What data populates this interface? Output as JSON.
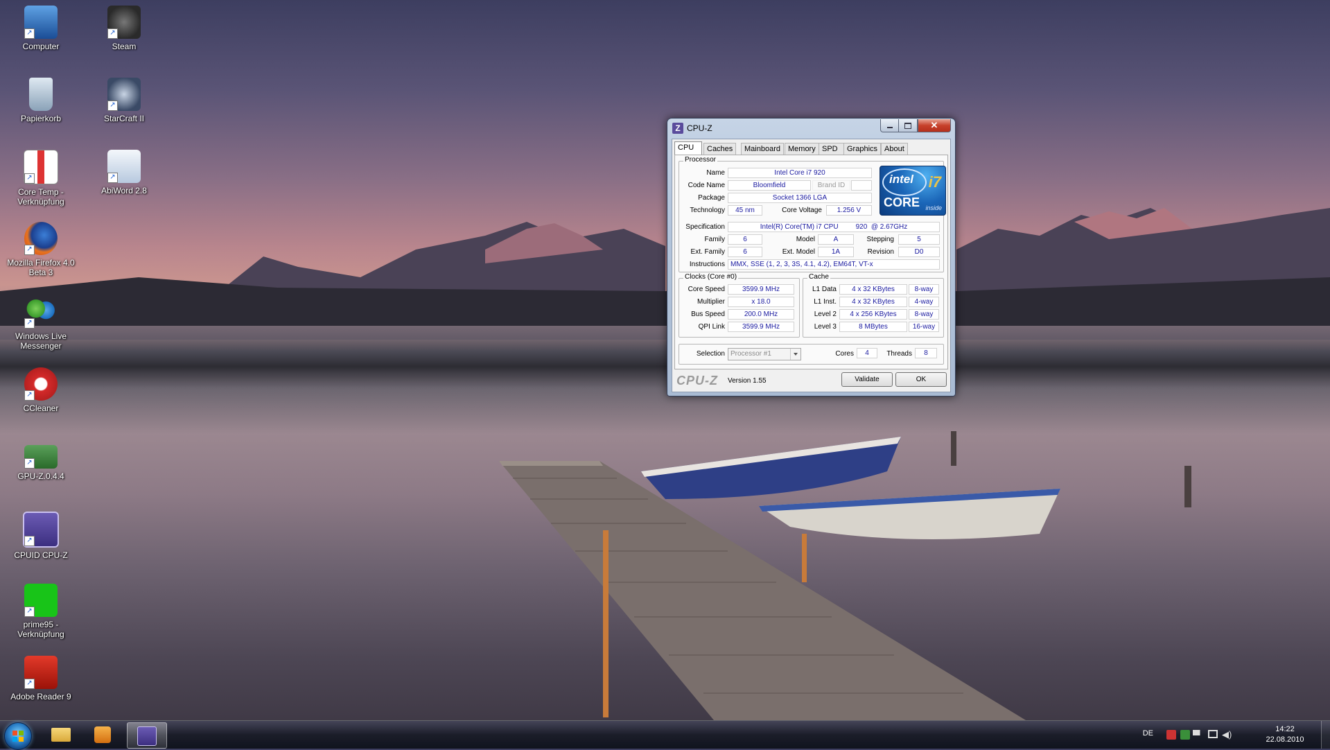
{
  "desktop": {
    "icons": [
      {
        "label": "Computer",
        "icon": "computer-icon"
      },
      {
        "label": "Steam",
        "icon": "steam-icon"
      },
      {
        "label": "Papierkorb",
        "icon": "recycle-bin-icon"
      },
      {
        "label": "StarCraft II",
        "icon": "starcraft-icon"
      },
      {
        "label": "Core Temp -\nVerknüpfung",
        "icon": "thermometer-icon"
      },
      {
        "label": "AbiWord 2.8",
        "icon": "abiword-icon"
      },
      {
        "label": "Mozilla Firefox 4.0\nBeta 3",
        "icon": "firefox-icon"
      },
      {
        "label": "Windows Live\nMessenger",
        "icon": "messenger-icon"
      },
      {
        "label": "CCleaner",
        "icon": "ccleaner-icon"
      },
      {
        "label": "GPU-Z.0.4.4",
        "icon": "gpu-card-icon"
      },
      {
        "label": "CPUID CPU-Z",
        "icon": "cpuz-icon"
      },
      {
        "label": "prime95 -\nVerknüpfung",
        "icon": "prime95-icon"
      },
      {
        "label": "Adobe Reader 9",
        "icon": "adobe-reader-icon"
      }
    ]
  },
  "window": {
    "title": "CPU-Z",
    "close_glyph": "✕",
    "tabs": [
      "CPU",
      "Caches",
      "Mainboard",
      "Memory",
      "SPD",
      "Graphics",
      "About"
    ],
    "selected_tab": "CPU",
    "processor": {
      "group_label": "Processor",
      "name_label": "Name",
      "name": "Intel Core i7 920",
      "codename_label": "Code Name",
      "codename": "Bloomfield",
      "brandid_label": "Brand ID",
      "package_label": "Package",
      "package": "Socket 1366 LGA",
      "technology_label": "Technology",
      "technology": "45 nm",
      "corevoltage_label": "Core Voltage",
      "corevoltage": "1.256 V",
      "spec_label": "Specification",
      "spec": "Intel(R) Core(TM) i7 CPU         920  @ 2.67GHz",
      "family_label": "Family",
      "family": "6",
      "model_label": "Model",
      "model": "A",
      "stepping_label": "Stepping",
      "stepping": "5",
      "extfamily_label": "Ext. Family",
      "extfamily": "6",
      "extmodel_label": "Ext. Model",
      "extmodel": "1A",
      "revision_label": "Revision",
      "revision": "D0",
      "instructions_label": "Instructions",
      "instructions": "MMX, SSE (1, 2, 3, 3S, 4.1, 4.2), EM64T, VT-x",
      "logo": {
        "brand": "intel",
        "core": "CORE",
        "model": "i7",
        "inside": "inside"
      }
    },
    "clocks": {
      "group_label": "Clocks (Core #0)",
      "corespeed_label": "Core Speed",
      "corespeed": "3599.9 MHz",
      "multiplier_label": "Multiplier",
      "multiplier": "x 18.0",
      "busspeed_label": "Bus Speed",
      "busspeed": "200.0 MHz",
      "qpilink_label": "QPI Link",
      "qpilink": "3599.9 MHz"
    },
    "cache": {
      "group_label": "Cache",
      "rows": [
        {
          "label": "L1 Data",
          "size": "4 x 32 KBytes",
          "assoc": "8-way"
        },
        {
          "label": "L1 Inst.",
          "size": "4 x 32 KBytes",
          "assoc": "4-way"
        },
        {
          "label": "Level 2",
          "size": "4 x 256 KBytes",
          "assoc": "8-way"
        },
        {
          "label": "Level 3",
          "size": "8 MBytes",
          "assoc": "16-way"
        }
      ]
    },
    "selection": {
      "label": "Selection",
      "value": "Processor #1",
      "cores_label": "Cores",
      "cores": "4",
      "threads_label": "Threads",
      "threads": "8"
    },
    "footer": {
      "logo": "CPU-Z",
      "version": "Version 1.55",
      "validate": "Validate",
      "ok": "OK"
    }
  },
  "taskbar": {
    "language": "DE",
    "time": "14:22",
    "date": "22.08.2010"
  }
}
